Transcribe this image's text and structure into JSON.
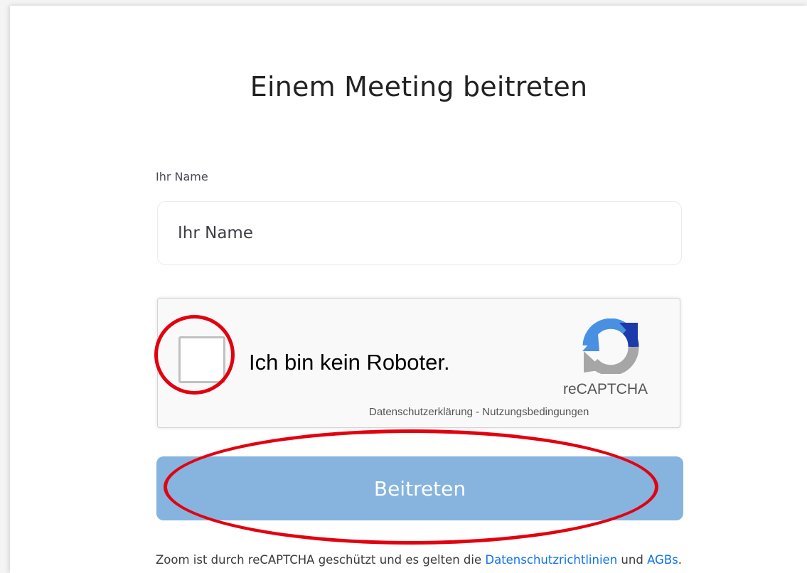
{
  "page": {
    "title": "Einem Meeting beitreten"
  },
  "form": {
    "name_label": "Ihr Name",
    "name_placeholder": "Ihr Name",
    "name_value": "",
    "join_button_label": "Beitreten"
  },
  "recaptcha": {
    "checkbox_label": "Ich bin kein Roboter.",
    "brand": "reCAPTCHA",
    "privacy_link": "Datenschutzerklärung",
    "separator": " - ",
    "terms_link": "Nutzungsbedingungen",
    "checked": false
  },
  "footer": {
    "text_before": "Zoom ist durch reCAPTCHA geschützt und es gelten die ",
    "privacy_link": "Datenschutzrichtlinien",
    "text_middle": " und ",
    "terms_link": "AGBs",
    "text_after": "."
  },
  "colors": {
    "join_button": "#86b4df",
    "link": "#0e72ed",
    "annotation": "#e3000f"
  }
}
